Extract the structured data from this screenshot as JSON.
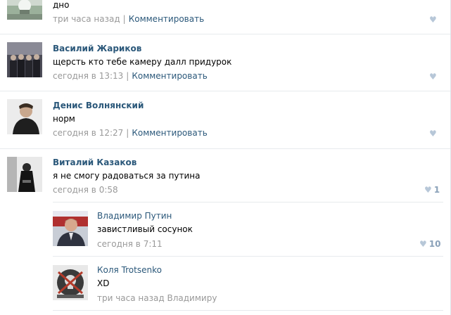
{
  "comments": [
    {
      "author": "",
      "text": "дно",
      "time": "три часа назад",
      "action": "Комментировать",
      "likes": "",
      "avatar_colors": [
        "#8aa08a",
        "#dde5dd",
        "#6a7a6a"
      ]
    },
    {
      "author": "Василий Жариков",
      "text": "щерсть кто тебе камеру далл придурок",
      "time": "сегодня в 13:13",
      "action": "Комментировать",
      "likes": "",
      "avatar_colors": [
        "#3a3a45",
        "#7a7a88",
        "#222228"
      ]
    },
    {
      "author": "Денис Волнянский",
      "text": "норм",
      "time": "сегодня в 12:27",
      "action": "Комментировать",
      "likes": "",
      "avatar_colors": [
        "#ececec",
        "#2a2a2a",
        "#c9a88e"
      ]
    },
    {
      "author": "Виталий Казаков",
      "text": "я не смогу радоваться за путина",
      "time": "сегодня в 0:58",
      "action": "",
      "likes": "1",
      "avatar_colors": [
        "#e9e9e9",
        "#151515",
        "#9a9a9a"
      ]
    }
  ],
  "replies": [
    {
      "author": "Владимир Путин",
      "text": "завистливый сосунок",
      "time": "сегодня в 7:11",
      "likes": "10",
      "avatar_colors": [
        "#c8cdd6",
        "#2f3340",
        "#d7a88d"
      ]
    },
    {
      "author": "Коля Trotsenko",
      "text": "XD",
      "time": "три часа назад",
      "reply_to": "Владимиру",
      "likes": "",
      "avatar_colors": [
        "#e8e8e8",
        "#3a3a3a",
        "#b33a2a"
      ]
    }
  ],
  "icons": {
    "like": "heart-icon"
  },
  "colors": {
    "link": "#2b587a",
    "meta": "#999999",
    "like": "#b7c7d8",
    "divider": "#e7eaed"
  }
}
